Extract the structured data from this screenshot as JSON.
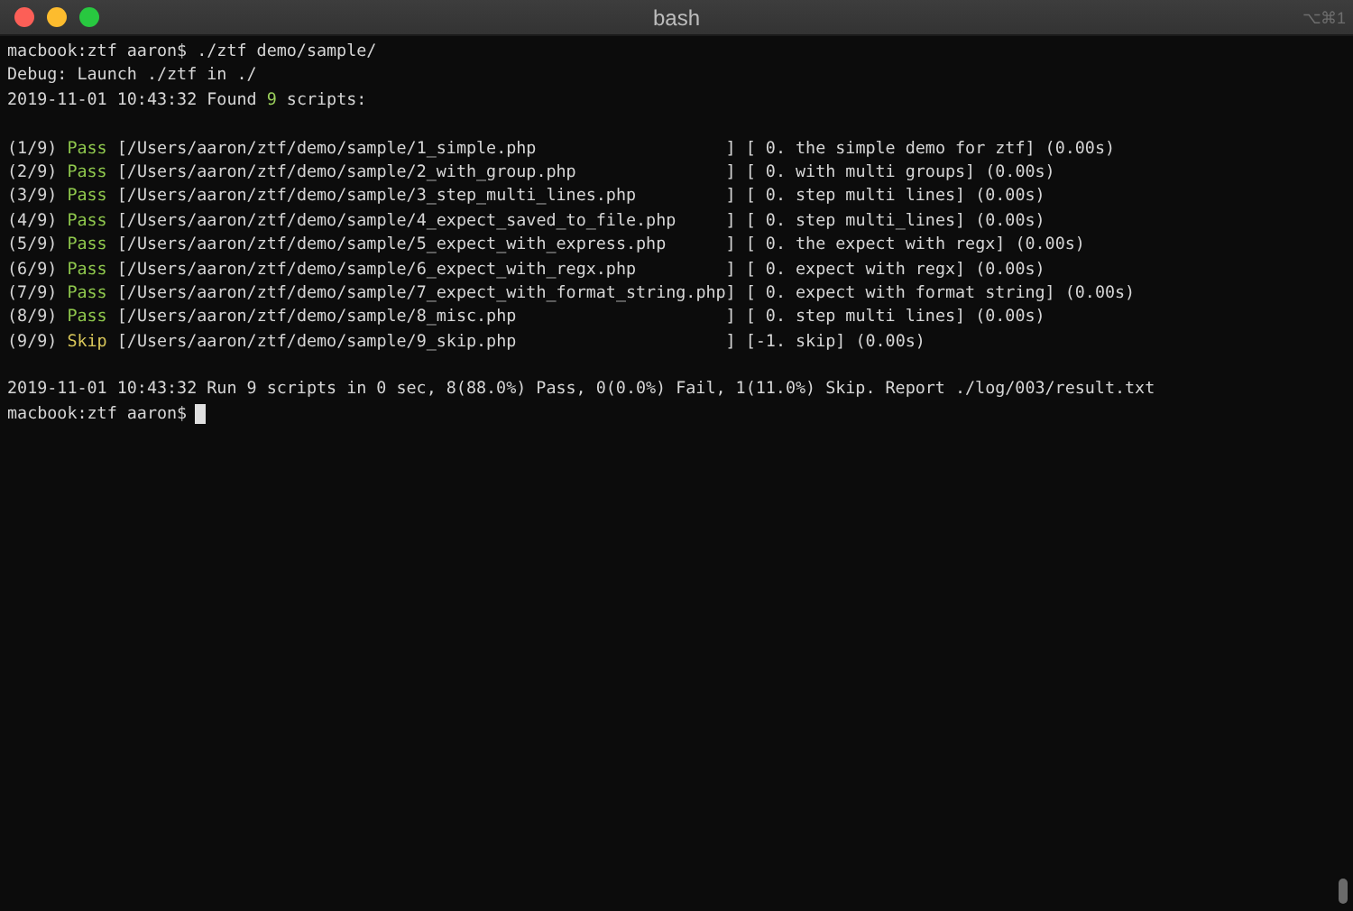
{
  "window": {
    "title": "bash",
    "shortcut": "⌥⌘1"
  },
  "header_lines": [
    {
      "text": "macbook:ztf aaron$ ./ztf demo/sample/"
    },
    {
      "text": "Debug: Launch ./ztf in ./"
    },
    {
      "before": "2019-11-01 10:43:32 Found ",
      "count": "9",
      "after": " scripts:"
    }
  ],
  "results": [
    {
      "index": "(1/9)",
      "status": "Pass",
      "kind": "pass",
      "path": "[/Users/aaron/ztf/demo/sample/1_simple.php",
      "detail": "] [ 0. the simple demo for ztf] (0.00s)"
    },
    {
      "index": "(2/9)",
      "status": "Pass",
      "kind": "pass",
      "path": "[/Users/aaron/ztf/demo/sample/2_with_group.php",
      "detail": "] [ 0. with multi groups] (0.00s)"
    },
    {
      "index": "(3/9)",
      "status": "Pass",
      "kind": "pass",
      "path": "[/Users/aaron/ztf/demo/sample/3_step_multi_lines.php",
      "detail": "] [ 0. step multi lines] (0.00s)"
    },
    {
      "index": "(4/9)",
      "status": "Pass",
      "kind": "pass",
      "path": "[/Users/aaron/ztf/demo/sample/4_expect_saved_to_file.php",
      "detail": "] [ 0. step multi_lines] (0.00s)"
    },
    {
      "index": "(5/9)",
      "status": "Pass",
      "kind": "pass",
      "path": "[/Users/aaron/ztf/demo/sample/5_expect_with_express.php",
      "detail": "] [ 0. the expect with regx] (0.00s)"
    },
    {
      "index": "(6/9)",
      "status": "Pass",
      "kind": "pass",
      "path": "[/Users/aaron/ztf/demo/sample/6_expect_with_regx.php",
      "detail": "] [ 0. expect with regx] (0.00s)"
    },
    {
      "index": "(7/9)",
      "status": "Pass",
      "kind": "pass",
      "path": "[/Users/aaron/ztf/demo/sample/7_expect_with_format_string.php",
      "detail": "] [ 0. expect with format string] (0.00s)"
    },
    {
      "index": "(8/9)",
      "status": "Pass",
      "kind": "pass",
      "path": "[/Users/aaron/ztf/demo/sample/8_misc.php",
      "detail": "] [ 0. step multi lines] (0.00s)"
    },
    {
      "index": "(9/9)",
      "status": "Skip",
      "kind": "skip",
      "path": "[/Users/aaron/ztf/demo/sample/9_skip.php",
      "detail": "] [-1. skip] (0.00s)"
    }
  ],
  "summary": "2019-11-01 10:43:32 Run 9 scripts in 0 sec, 8(88.0%) Pass, 0(0.0%) Fail, 1(11.0%) Skip. Report ./log/003/result.txt",
  "prompt": "macbook:ztf aaron$"
}
